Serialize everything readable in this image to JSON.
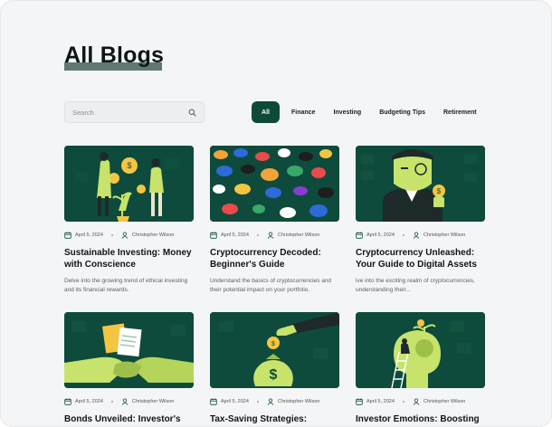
{
  "page": {
    "title": "All Blogs"
  },
  "search": {
    "placeholder": "Search"
  },
  "filters": [
    "All",
    "Finance",
    "Investing",
    "Budgeting Tips",
    "Retirement"
  ],
  "active_filter": "All",
  "posts": [
    {
      "date": "April 5, 2024",
      "author": "Christopher Wilson",
      "title": "Sustainable Investing: Money with Conscience",
      "excerpt": "Delve into the growing trend of ethical investing and its financial rewards.",
      "image": "people-with-coins-plant"
    },
    {
      "date": "April 5, 2024",
      "author": "Christopher Wilson",
      "title": "Cryptocurrency Decoded: Beginner's Guide",
      "excerpt": "Understand the basics of cryptocurrencies and their potential impact on your portfolio.",
      "image": "crypto-coins"
    },
    {
      "date": "April 5, 2024",
      "author": "Christopher Wilson",
      "title": "Cryptocurrency Unleashed: Your Guide to Digital Assets",
      "excerpt": "ive into the exciting realm of cryptocurrencies, understanding their...",
      "image": "man-with-monocle-coin"
    },
    {
      "date": "April 5, 2024",
      "author": "Christopher Wilson",
      "title": "Bonds Unveiled: Investor's",
      "excerpt": "",
      "image": "handshake-documents"
    },
    {
      "date": "April 5, 2024",
      "author": "Christopher Wilson",
      "title": "Tax-Saving Strategies:",
      "excerpt": "",
      "image": "hand-money-bag"
    },
    {
      "date": "April 5, 2024",
      "author": "Christopher Wilson",
      "title": "Investor Emotions: Boosting",
      "excerpt": "",
      "image": "head-growth-ladder"
    }
  ],
  "colors": {
    "brand": "#0d4a3a",
    "thumb_bg": "#0e4b3c",
    "accent": "#c7e36b",
    "coin": "#f4c542"
  },
  "icons": {
    "search": "search-icon",
    "date": "calendar-icon",
    "author": "user-icon"
  }
}
